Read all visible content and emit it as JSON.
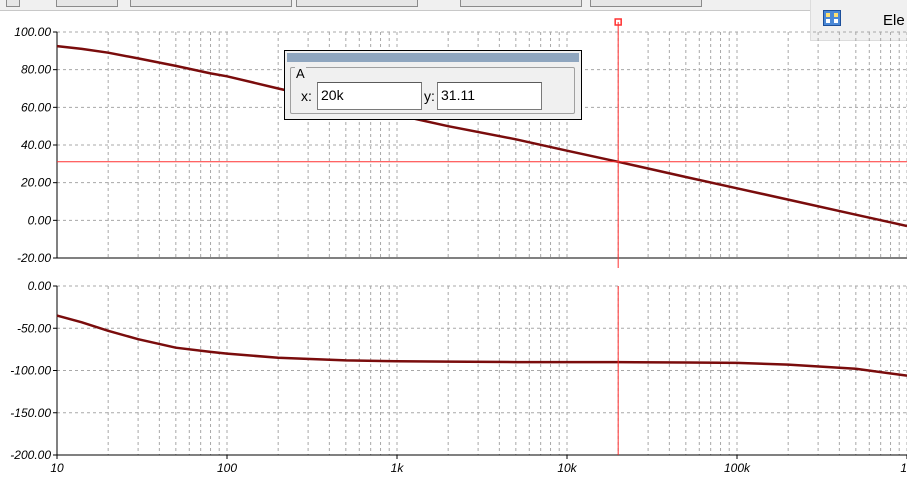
{
  "side_panel": {
    "label": "Ele",
    "icon": "grid-icon"
  },
  "cursor_readout": {
    "group_label": "A",
    "x_label": "x:",
    "x_value": "20k",
    "y_label": "y:",
    "y_value": "31.11"
  },
  "colors": {
    "series": "#7a0c0c",
    "cursor": "#ff3030",
    "grid": "#a8a8a8"
  },
  "chart_data": [
    {
      "type": "line",
      "x_scale": "log",
      "xlim": [
        10,
        1000000
      ],
      "ylim": [
        -20,
        100
      ],
      "ytick_labels": [
        "100.00",
        "80.00",
        "60.00",
        "40.00",
        "20.00",
        "0.00",
        "-20.00"
      ],
      "ytick_values": [
        100,
        80,
        60,
        40,
        20,
        0,
        -20
      ],
      "grid": true,
      "series": [
        {
          "x": [
            10,
            14,
            20,
            30,
            50,
            80,
            100,
            200,
            500,
            1000,
            2000,
            5000,
            10000,
            20000,
            50000,
            100000,
            200000,
            500000,
            1000000
          ],
          "y": [
            92.5,
            91,
            89,
            86,
            82,
            78,
            76.5,
            70,
            62,
            56,
            50,
            43,
            37,
            31.1,
            23,
            17,
            11,
            3,
            -3
          ]
        }
      ],
      "cursor": {
        "x": 20000,
        "y": 31.11
      }
    },
    {
      "type": "line",
      "x_scale": "log",
      "xlim": [
        10,
        1000000
      ],
      "ylim": [
        -200,
        0
      ],
      "ytick_labels": [
        "0.00",
        "-50.00",
        "-100.00",
        "-150.00",
        "-200.00"
      ],
      "ytick_values": [
        0,
        -50,
        -100,
        -150,
        -200
      ],
      "xtick_labels": [
        "10",
        "100",
        "1k",
        "10k",
        "100k",
        "1"
      ],
      "xtick_values": [
        10,
        100,
        1000,
        10000,
        100000,
        1000000
      ],
      "grid": true,
      "series": [
        {
          "x": [
            10,
            14,
            20,
            30,
            50,
            80,
            100,
            200,
            500,
            1000,
            2000,
            5000,
            10000,
            20000,
            50000,
            100000,
            200000,
            500000,
            1000000
          ],
          "y": [
            -35,
            -43,
            -53,
            -63,
            -73,
            -78,
            -80,
            -85,
            -88,
            -89,
            -89.5,
            -90,
            -90,
            -90,
            -90.5,
            -91,
            -93,
            -98,
            -106
          ]
        }
      ],
      "cursor": {
        "x": 20000
      }
    }
  ]
}
